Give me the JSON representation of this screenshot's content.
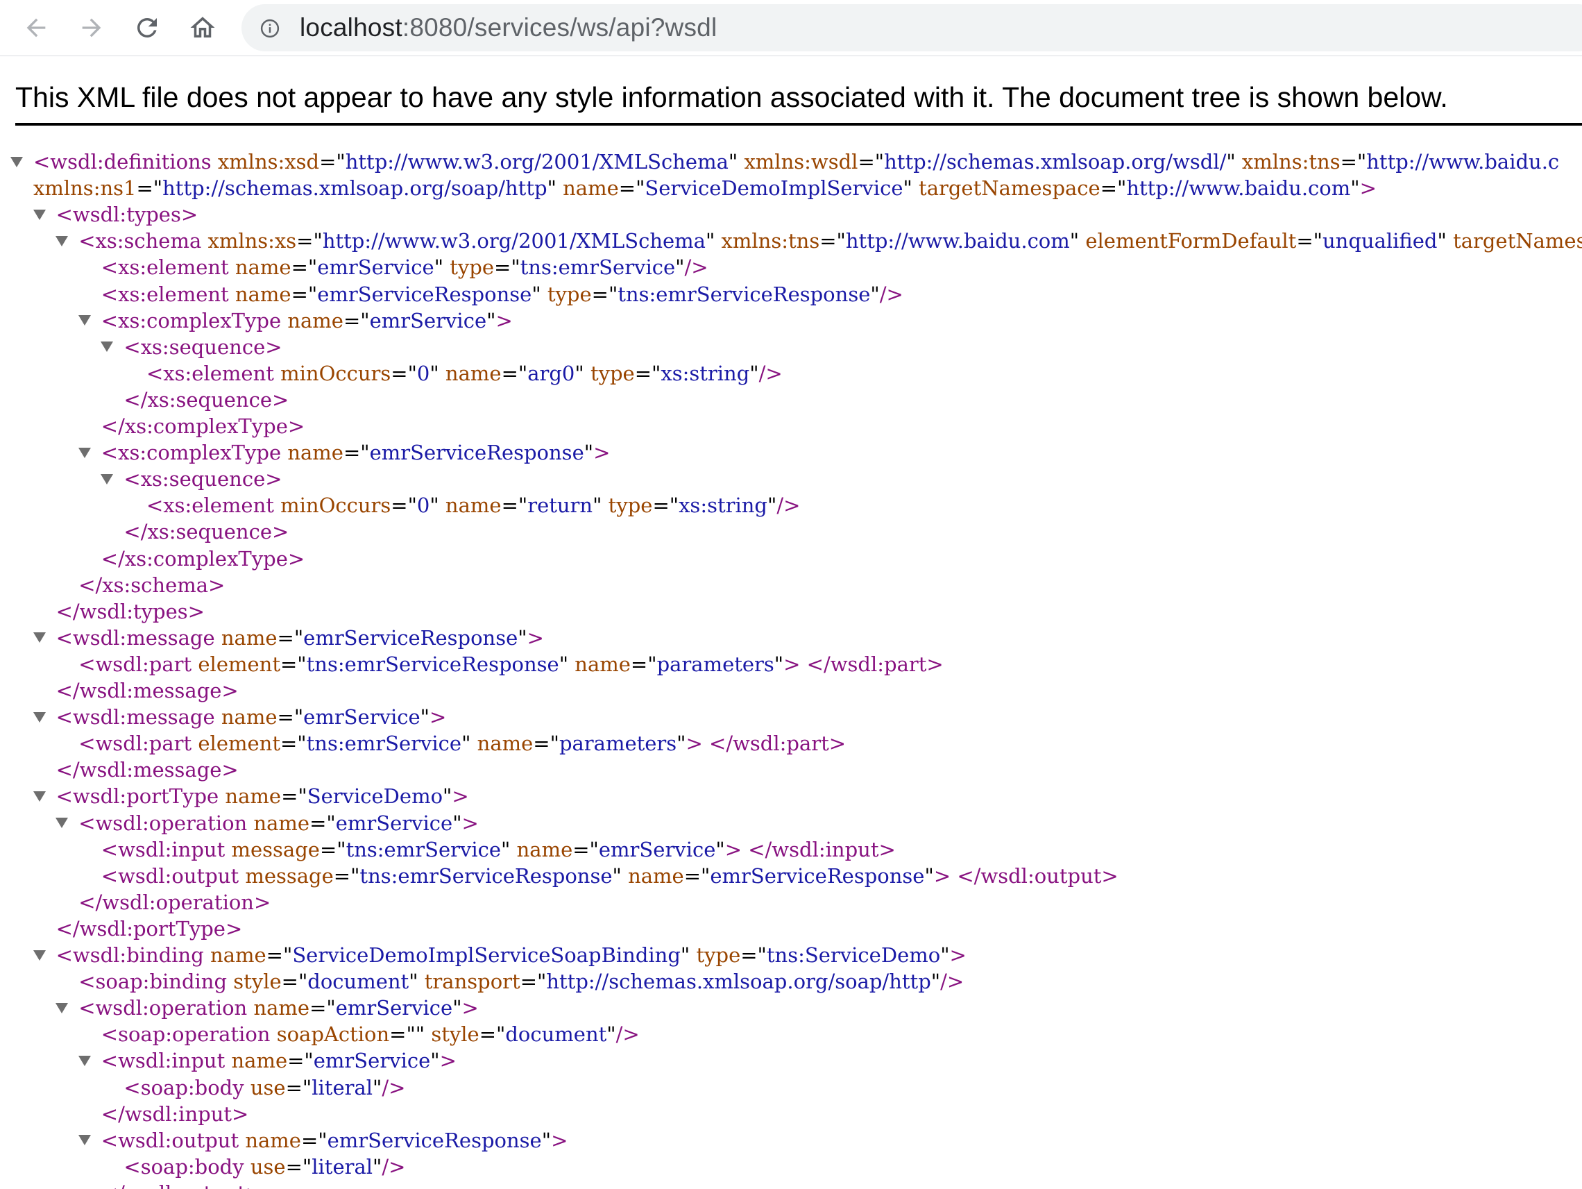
{
  "browser": {
    "url_host": "localhost",
    "url_rest": ":8080/services/ws/api?wsdl",
    "nav_icons": [
      "back-arrow-icon",
      "forward-arrow-icon",
      "reload-icon",
      "home-icon",
      "info-icon"
    ]
  },
  "page": {
    "notice": "This XML file does not appear to have any style information associated with it. The document tree is shown below."
  },
  "colors": {
    "tag": "#881280",
    "attr_name": "#994500",
    "attr_value": "#1a1aa6",
    "toggle": "#6e6e6e"
  },
  "xml_lines": [
    {
      "indent": 0,
      "toggle": true,
      "parts": [
        [
          "t",
          "<wsdl:definitions"
        ],
        [
          "t",
          " "
        ],
        [
          "n",
          "xmlns:xsd"
        ],
        [
          "e",
          "=\""
        ],
        [
          "v",
          "http://www.w3.org/2001/XMLSchema"
        ],
        [
          "e",
          "\""
        ],
        [
          "t",
          " "
        ],
        [
          "n",
          "xmlns:wsdl"
        ],
        [
          "e",
          "=\""
        ],
        [
          "v",
          "http://schemas.xmlsoap.org/wsdl/"
        ],
        [
          "e",
          "\""
        ],
        [
          "t",
          " "
        ],
        [
          "n",
          "xmlns:tns"
        ],
        [
          "e",
          "=\""
        ],
        [
          "v",
          "http://www.baidu.c"
        ]
      ]
    },
    {
      "indent": 0,
      "toggle": false,
      "cont": true,
      "parts": [
        [
          "n",
          "xmlns:ns1"
        ],
        [
          "e",
          "=\""
        ],
        [
          "v",
          "http://schemas.xmlsoap.org/soap/http"
        ],
        [
          "e",
          "\""
        ],
        [
          "t",
          " "
        ],
        [
          "n",
          "name"
        ],
        [
          "e",
          "=\""
        ],
        [
          "v",
          "ServiceDemoImplService"
        ],
        [
          "e",
          "\""
        ],
        [
          "t",
          " "
        ],
        [
          "n",
          "targetNamespace"
        ],
        [
          "e",
          "=\""
        ],
        [
          "v",
          "http://www.baidu.com"
        ],
        [
          "e",
          "\""
        ],
        [
          "t",
          ">"
        ]
      ]
    },
    {
      "indent": 1,
      "toggle": true,
      "parts": [
        [
          "t",
          "<wsdl:types>"
        ]
      ]
    },
    {
      "indent": 2,
      "toggle": true,
      "parts": [
        [
          "t",
          "<xs:schema"
        ],
        [
          "t",
          " "
        ],
        [
          "n",
          "xmlns:xs"
        ],
        [
          "e",
          "=\""
        ],
        [
          "v",
          "http://www.w3.org/2001/XMLSchema"
        ],
        [
          "e",
          "\""
        ],
        [
          "t",
          " "
        ],
        [
          "n",
          "xmlns:tns"
        ],
        [
          "e",
          "=\""
        ],
        [
          "v",
          "http://www.baidu.com"
        ],
        [
          "e",
          "\""
        ],
        [
          "t",
          " "
        ],
        [
          "n",
          "elementFormDefault"
        ],
        [
          "e",
          "=\""
        ],
        [
          "v",
          "unqualified"
        ],
        [
          "e",
          "\""
        ],
        [
          "t",
          " "
        ],
        [
          "n",
          "targetNamespa"
        ]
      ]
    },
    {
      "indent": 3,
      "toggle": false,
      "parts": [
        [
          "t",
          "<xs:element"
        ],
        [
          "t",
          " "
        ],
        [
          "n",
          "name"
        ],
        [
          "e",
          "=\""
        ],
        [
          "v",
          "emrService"
        ],
        [
          "e",
          "\""
        ],
        [
          "t",
          " "
        ],
        [
          "n",
          "type"
        ],
        [
          "e",
          "=\""
        ],
        [
          "v",
          "tns:emrService"
        ],
        [
          "e",
          "\""
        ],
        [
          "t",
          "/>"
        ]
      ]
    },
    {
      "indent": 3,
      "toggle": false,
      "parts": [
        [
          "t",
          "<xs:element"
        ],
        [
          "t",
          " "
        ],
        [
          "n",
          "name"
        ],
        [
          "e",
          "=\""
        ],
        [
          "v",
          "emrServiceResponse"
        ],
        [
          "e",
          "\""
        ],
        [
          "t",
          " "
        ],
        [
          "n",
          "type"
        ],
        [
          "e",
          "=\""
        ],
        [
          "v",
          "tns:emrServiceResponse"
        ],
        [
          "e",
          "\""
        ],
        [
          "t",
          "/>"
        ]
      ]
    },
    {
      "indent": 3,
      "toggle": true,
      "parts": [
        [
          "t",
          "<xs:complexType"
        ],
        [
          "t",
          " "
        ],
        [
          "n",
          "name"
        ],
        [
          "e",
          "=\""
        ],
        [
          "v",
          "emrService"
        ],
        [
          "e",
          "\""
        ],
        [
          "t",
          ">"
        ]
      ]
    },
    {
      "indent": 4,
      "toggle": true,
      "parts": [
        [
          "t",
          "<xs:sequence>"
        ]
      ]
    },
    {
      "indent": 5,
      "toggle": false,
      "parts": [
        [
          "t",
          "<xs:element"
        ],
        [
          "t",
          " "
        ],
        [
          "n",
          "minOccurs"
        ],
        [
          "e",
          "=\""
        ],
        [
          "v",
          "0"
        ],
        [
          "e",
          "\""
        ],
        [
          "t",
          " "
        ],
        [
          "n",
          "name"
        ],
        [
          "e",
          "=\""
        ],
        [
          "v",
          "arg0"
        ],
        [
          "e",
          "\""
        ],
        [
          "t",
          " "
        ],
        [
          "n",
          "type"
        ],
        [
          "e",
          "=\""
        ],
        [
          "v",
          "xs:string"
        ],
        [
          "e",
          "\""
        ],
        [
          "t",
          "/>"
        ]
      ]
    },
    {
      "indent": 4,
      "toggle": false,
      "parts": [
        [
          "t",
          "</xs:sequence>"
        ]
      ]
    },
    {
      "indent": 3,
      "toggle": false,
      "parts": [
        [
          "t",
          "</xs:complexType>"
        ]
      ]
    },
    {
      "indent": 3,
      "toggle": true,
      "parts": [
        [
          "t",
          "<xs:complexType"
        ],
        [
          "t",
          " "
        ],
        [
          "n",
          "name"
        ],
        [
          "e",
          "=\""
        ],
        [
          "v",
          "emrServiceResponse"
        ],
        [
          "e",
          "\""
        ],
        [
          "t",
          ">"
        ]
      ]
    },
    {
      "indent": 4,
      "toggle": true,
      "parts": [
        [
          "t",
          "<xs:sequence>"
        ]
      ]
    },
    {
      "indent": 5,
      "toggle": false,
      "parts": [
        [
          "t",
          "<xs:element"
        ],
        [
          "t",
          " "
        ],
        [
          "n",
          "minOccurs"
        ],
        [
          "e",
          "=\""
        ],
        [
          "v",
          "0"
        ],
        [
          "e",
          "\""
        ],
        [
          "t",
          " "
        ],
        [
          "n",
          "name"
        ],
        [
          "e",
          "=\""
        ],
        [
          "v",
          "return"
        ],
        [
          "e",
          "\""
        ],
        [
          "t",
          " "
        ],
        [
          "n",
          "type"
        ],
        [
          "e",
          "=\""
        ],
        [
          "v",
          "xs:string"
        ],
        [
          "e",
          "\""
        ],
        [
          "t",
          "/>"
        ]
      ]
    },
    {
      "indent": 4,
      "toggle": false,
      "parts": [
        [
          "t",
          "</xs:sequence>"
        ]
      ]
    },
    {
      "indent": 3,
      "toggle": false,
      "parts": [
        [
          "t",
          "</xs:complexType>"
        ]
      ]
    },
    {
      "indent": 2,
      "toggle": false,
      "parts": [
        [
          "t",
          "</xs:schema>"
        ]
      ]
    },
    {
      "indent": 1,
      "toggle": false,
      "parts": [
        [
          "t",
          "</wsdl:types>"
        ]
      ]
    },
    {
      "indent": 1,
      "toggle": true,
      "parts": [
        [
          "t",
          "<wsdl:message"
        ],
        [
          "t",
          " "
        ],
        [
          "n",
          "name"
        ],
        [
          "e",
          "=\""
        ],
        [
          "v",
          "emrServiceResponse"
        ],
        [
          "e",
          "\""
        ],
        [
          "t",
          ">"
        ]
      ]
    },
    {
      "indent": 2,
      "toggle": false,
      "parts": [
        [
          "t",
          "<wsdl:part"
        ],
        [
          "t",
          " "
        ],
        [
          "n",
          "element"
        ],
        [
          "e",
          "=\""
        ],
        [
          "v",
          "tns:emrServiceResponse"
        ],
        [
          "e",
          "\""
        ],
        [
          "t",
          " "
        ],
        [
          "n",
          "name"
        ],
        [
          "e",
          "=\""
        ],
        [
          "v",
          "parameters"
        ],
        [
          "e",
          "\""
        ],
        [
          "t",
          "> </wsdl:part>"
        ]
      ]
    },
    {
      "indent": 1,
      "toggle": false,
      "parts": [
        [
          "t",
          "</wsdl:message>"
        ]
      ]
    },
    {
      "indent": 1,
      "toggle": true,
      "parts": [
        [
          "t",
          "<wsdl:message"
        ],
        [
          "t",
          " "
        ],
        [
          "n",
          "name"
        ],
        [
          "e",
          "=\""
        ],
        [
          "v",
          "emrService"
        ],
        [
          "e",
          "\""
        ],
        [
          "t",
          ">"
        ]
      ]
    },
    {
      "indent": 2,
      "toggle": false,
      "parts": [
        [
          "t",
          "<wsdl:part"
        ],
        [
          "t",
          " "
        ],
        [
          "n",
          "element"
        ],
        [
          "e",
          "=\""
        ],
        [
          "v",
          "tns:emrService"
        ],
        [
          "e",
          "\""
        ],
        [
          "t",
          " "
        ],
        [
          "n",
          "name"
        ],
        [
          "e",
          "=\""
        ],
        [
          "v",
          "parameters"
        ],
        [
          "e",
          "\""
        ],
        [
          "t",
          "> </wsdl:part>"
        ]
      ]
    },
    {
      "indent": 1,
      "toggle": false,
      "parts": [
        [
          "t",
          "</wsdl:message>"
        ]
      ]
    },
    {
      "indent": 1,
      "toggle": true,
      "parts": [
        [
          "t",
          "<wsdl:portType"
        ],
        [
          "t",
          " "
        ],
        [
          "n",
          "name"
        ],
        [
          "e",
          "=\""
        ],
        [
          "v",
          "ServiceDemo"
        ],
        [
          "e",
          "\""
        ],
        [
          "t",
          ">"
        ]
      ]
    },
    {
      "indent": 2,
      "toggle": true,
      "parts": [
        [
          "t",
          "<wsdl:operation"
        ],
        [
          "t",
          " "
        ],
        [
          "n",
          "name"
        ],
        [
          "e",
          "=\""
        ],
        [
          "v",
          "emrService"
        ],
        [
          "e",
          "\""
        ],
        [
          "t",
          ">"
        ]
      ]
    },
    {
      "indent": 3,
      "toggle": false,
      "parts": [
        [
          "t",
          "<wsdl:input"
        ],
        [
          "t",
          " "
        ],
        [
          "n",
          "message"
        ],
        [
          "e",
          "=\""
        ],
        [
          "v",
          "tns:emrService"
        ],
        [
          "e",
          "\""
        ],
        [
          "t",
          " "
        ],
        [
          "n",
          "name"
        ],
        [
          "e",
          "=\""
        ],
        [
          "v",
          "emrService"
        ],
        [
          "e",
          "\""
        ],
        [
          "t",
          "> </wsdl:input>"
        ]
      ]
    },
    {
      "indent": 3,
      "toggle": false,
      "parts": [
        [
          "t",
          "<wsdl:output"
        ],
        [
          "t",
          " "
        ],
        [
          "n",
          "message"
        ],
        [
          "e",
          "=\""
        ],
        [
          "v",
          "tns:emrServiceResponse"
        ],
        [
          "e",
          "\""
        ],
        [
          "t",
          " "
        ],
        [
          "n",
          "name"
        ],
        [
          "e",
          "=\""
        ],
        [
          "v",
          "emrServiceResponse"
        ],
        [
          "e",
          "\""
        ],
        [
          "t",
          "> </wsdl:output>"
        ]
      ]
    },
    {
      "indent": 2,
      "toggle": false,
      "parts": [
        [
          "t",
          "</wsdl:operation>"
        ]
      ]
    },
    {
      "indent": 1,
      "toggle": false,
      "parts": [
        [
          "t",
          "</wsdl:portType>"
        ]
      ]
    },
    {
      "indent": 1,
      "toggle": true,
      "parts": [
        [
          "t",
          "<wsdl:binding"
        ],
        [
          "t",
          " "
        ],
        [
          "n",
          "name"
        ],
        [
          "e",
          "=\""
        ],
        [
          "v",
          "ServiceDemoImplServiceSoapBinding"
        ],
        [
          "e",
          "\""
        ],
        [
          "t",
          " "
        ],
        [
          "n",
          "type"
        ],
        [
          "e",
          "=\""
        ],
        [
          "v",
          "tns:ServiceDemo"
        ],
        [
          "e",
          "\""
        ],
        [
          "t",
          ">"
        ]
      ]
    },
    {
      "indent": 2,
      "toggle": false,
      "parts": [
        [
          "t",
          "<soap:binding"
        ],
        [
          "t",
          " "
        ],
        [
          "n",
          "style"
        ],
        [
          "e",
          "=\""
        ],
        [
          "v",
          "document"
        ],
        [
          "e",
          "\""
        ],
        [
          "t",
          " "
        ],
        [
          "n",
          "transport"
        ],
        [
          "e",
          "=\""
        ],
        [
          "v",
          "http://schemas.xmlsoap.org/soap/http"
        ],
        [
          "e",
          "\""
        ],
        [
          "t",
          "/>"
        ]
      ]
    },
    {
      "indent": 2,
      "toggle": true,
      "parts": [
        [
          "t",
          "<wsdl:operation"
        ],
        [
          "t",
          " "
        ],
        [
          "n",
          "name"
        ],
        [
          "e",
          "=\""
        ],
        [
          "v",
          "emrService"
        ],
        [
          "e",
          "\""
        ],
        [
          "t",
          ">"
        ]
      ]
    },
    {
      "indent": 3,
      "toggle": false,
      "parts": [
        [
          "t",
          "<soap:operation"
        ],
        [
          "t",
          " "
        ],
        [
          "n",
          "soapAction"
        ],
        [
          "e",
          "=\"\""
        ],
        [
          "t",
          " "
        ],
        [
          "n",
          "style"
        ],
        [
          "e",
          "=\""
        ],
        [
          "v",
          "document"
        ],
        [
          "e",
          "\""
        ],
        [
          "t",
          "/>"
        ]
      ]
    },
    {
      "indent": 3,
      "toggle": true,
      "parts": [
        [
          "t",
          "<wsdl:input"
        ],
        [
          "t",
          " "
        ],
        [
          "n",
          "name"
        ],
        [
          "e",
          "=\""
        ],
        [
          "v",
          "emrService"
        ],
        [
          "e",
          "\""
        ],
        [
          "t",
          ">"
        ]
      ]
    },
    {
      "indent": 4,
      "toggle": false,
      "parts": [
        [
          "t",
          "<soap:body"
        ],
        [
          "t",
          " "
        ],
        [
          "n",
          "use"
        ],
        [
          "e",
          "=\""
        ],
        [
          "v",
          "literal"
        ],
        [
          "e",
          "\""
        ],
        [
          "t",
          "/>"
        ]
      ]
    },
    {
      "indent": 3,
      "toggle": false,
      "parts": [
        [
          "t",
          "</wsdl:input>"
        ]
      ]
    },
    {
      "indent": 3,
      "toggle": true,
      "parts": [
        [
          "t",
          "<wsdl:output"
        ],
        [
          "t",
          " "
        ],
        [
          "n",
          "name"
        ],
        [
          "e",
          "=\""
        ],
        [
          "v",
          "emrServiceResponse"
        ],
        [
          "e",
          "\""
        ],
        [
          "t",
          ">"
        ]
      ]
    },
    {
      "indent": 4,
      "toggle": false,
      "parts": [
        [
          "t",
          "<soap:body"
        ],
        [
          "t",
          " "
        ],
        [
          "n",
          "use"
        ],
        [
          "e",
          "=\""
        ],
        [
          "v",
          "literal"
        ],
        [
          "e",
          "\""
        ],
        [
          "t",
          "/>"
        ]
      ]
    },
    {
      "indent": 3,
      "toggle": false,
      "parts": [
        [
          "t",
          "</wsdl:output>"
        ]
      ]
    }
  ]
}
